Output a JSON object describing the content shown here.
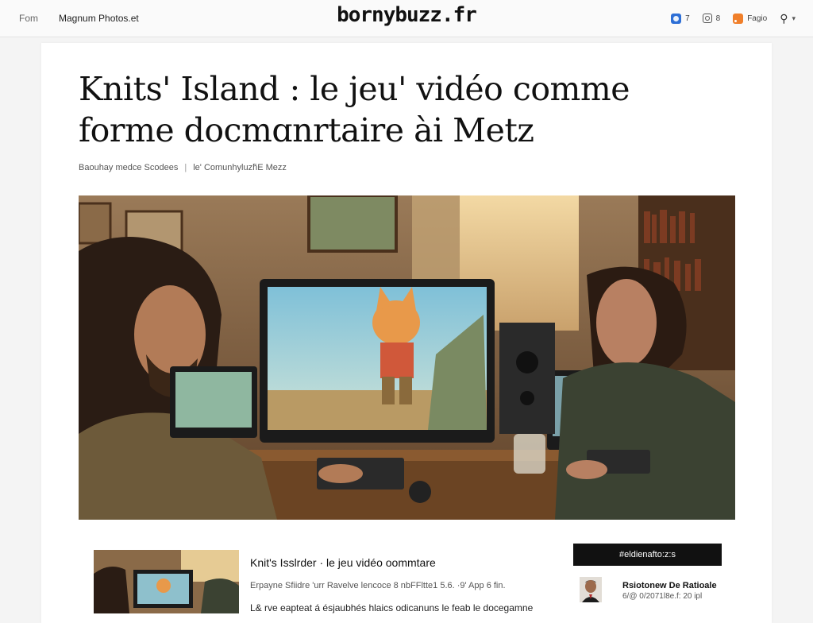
{
  "header": {
    "nav_home": "Fom",
    "nav_source": "Magnum Photos.et",
    "site_title": "bornybuzz.fr",
    "nav_right": [
      {
        "icon": "facebook-icon",
        "label": "7"
      },
      {
        "icon": "instagram-icon",
        "label": "8"
      },
      {
        "icon": "rss-icon",
        "label": "Fagio"
      }
    ],
    "search_icon": "search-icon"
  },
  "article": {
    "title_line1": "Knits' Island : le jeu' vidéo comme",
    "title_line2": "forme docmɑnrtaire ài Metz",
    "byline_author": "Baouhay medce Scodees",
    "byline_sep": "|",
    "byline_place": "le' Comunhyluzh̃E Mezz"
  },
  "related": {
    "title": "Knit's Isslrder  ·  le jeu vidéo oommtare",
    "meta": "Erpayne Sfiidre 'urr Ravelve lencoce  8 nbFFltte1 5.6.  ·9' App 6 fin.",
    "excerpt": "L& rve eapteat á ésjaubhés hlaics odicanuns le feab le docegamne"
  },
  "sidebar": {
    "heading": "#eldienafto:z:s",
    "items": [
      {
        "name": "Rsiotonew De Ratioale",
        "date": "6/@ 0/2071l8e.f: 20 ipl"
      }
    ]
  },
  "colors": {
    "accent_blue": "#2e6fd6",
    "rss_orange": "#f07f2a",
    "header_bg": "#fafafa",
    "sidebar_head_bg": "#111111"
  }
}
